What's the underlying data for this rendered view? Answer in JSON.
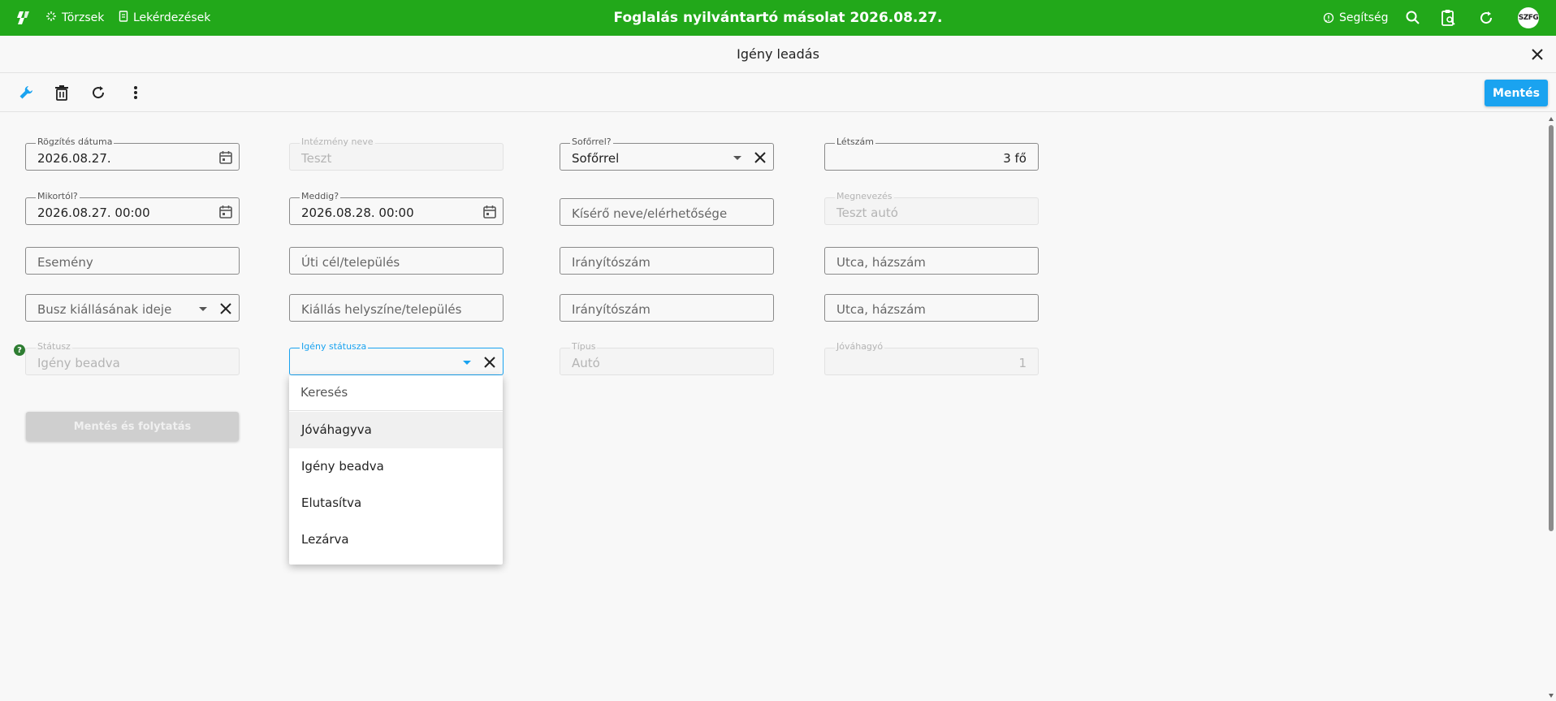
{
  "topbar": {
    "nav_torzsek": "Törzsek",
    "nav_lekerdezesek": "Lekérdezések",
    "title": "Foglalás nyilvántartó másolat 2026.08.27.",
    "help_label": "Segítség",
    "avatar_initials": "SZFG"
  },
  "page": {
    "subtitle": "Igény leadás"
  },
  "toolbar": {
    "save_label": "Mentés"
  },
  "form": {
    "rogzites_datuma": {
      "label": "Rögzítés dátuma",
      "value": "2026.08.27."
    },
    "intezmeny_neve": {
      "label": "Intézmény neve",
      "value": "Teszt"
    },
    "soforrel": {
      "label": "Sofőrrel?",
      "value": "Sofőrrel"
    },
    "letszam": {
      "label": "Létszám",
      "value": "3 fő"
    },
    "mikortol": {
      "label": "Mikortól?",
      "value": "2026.08.27. 00:00"
    },
    "meddig": {
      "label": "Meddig?",
      "value": "2026.08.28. 00:00"
    },
    "kisero": {
      "placeholder": "Kísérő neve/elérhetősége"
    },
    "megnevezes": {
      "label": "Megnevezés",
      "value": "Teszt autó"
    },
    "esemeny": {
      "placeholder": "Esemény"
    },
    "uti_cel": {
      "placeholder": "Úti cél/település"
    },
    "iranyitoszam_1": {
      "placeholder": "Irányítószám"
    },
    "utca_1": {
      "placeholder": "Utca, házszám"
    },
    "busz_kiallas_ideje": {
      "placeholder": "Busz kiállásának ideje"
    },
    "kiallas_helyszine": {
      "placeholder": "Kiállás helyszíne/település"
    },
    "iranyitoszam_2": {
      "placeholder": "Irányítószám"
    },
    "utca_2": {
      "placeholder": "Utca, házszám"
    },
    "statusz": {
      "label": "Státusz",
      "value": "Igény beadva"
    },
    "igeny_statusza": {
      "label": "Igény státusza",
      "value": ""
    },
    "tipus": {
      "label": "Típus",
      "value": "Autó"
    },
    "jovahagyo": {
      "label": "Jóváhagyó",
      "value": "1"
    },
    "help_mark": "?",
    "continue_label": "Mentés és folytatás"
  },
  "status_dropdown": {
    "search_placeholder": "Keresés",
    "options": [
      "Jóváhagyva",
      "Igény beadva",
      "Elutasítva",
      "Lezárva"
    ],
    "highlighted_index": 0
  },
  "colors": {
    "topbar_green": "#22a81a",
    "primary_blue": "#1aa3f0",
    "help_green": "#2e7d32"
  }
}
